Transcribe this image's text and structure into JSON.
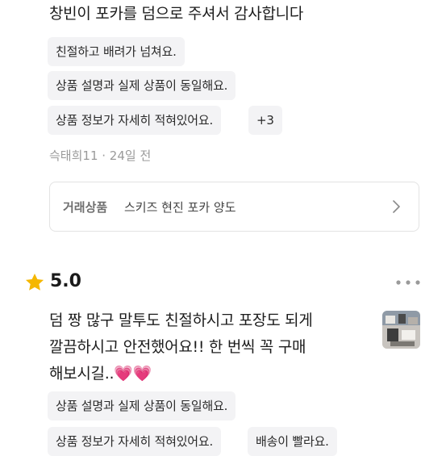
{
  "review1": {
    "text": "창빈이 포카를 덤으로 주셔서 감사합니다",
    "tags": [
      "친절하고 배려가 넘쳐요.",
      "상품 설명과 실제 상품이 동일해요.",
      "상품 정보가 자세히 적혀있어요."
    ],
    "more_count": "+3",
    "meta": "슥태희11 · 24일 전",
    "trade": {
      "label": "거래상품",
      "item": "스키즈 현진 포카 양도"
    }
  },
  "review2": {
    "rating": "5.0",
    "text_lines": [
      "덤 짱 많구 말투도 친절하시고 포장도 되게",
      "깔끔하시고 안전했어요!! 한 번씩 꼭 구매",
      "해보시길..💗💗"
    ],
    "tags": [
      "상품 설명과 실제 상품이 동일해요.",
      "상품 정보가 자세히 적혀있어요.",
      "배송이 빨라요."
    ]
  },
  "icons": {
    "star": "star-icon",
    "more": "more-options-icon",
    "chevron": "chevron-right-icon"
  },
  "colors": {
    "star": "#f5b700",
    "tag_bg": "#f3f3f5",
    "meta": "#9a9a9a",
    "heart": "#ff3d6e"
  }
}
